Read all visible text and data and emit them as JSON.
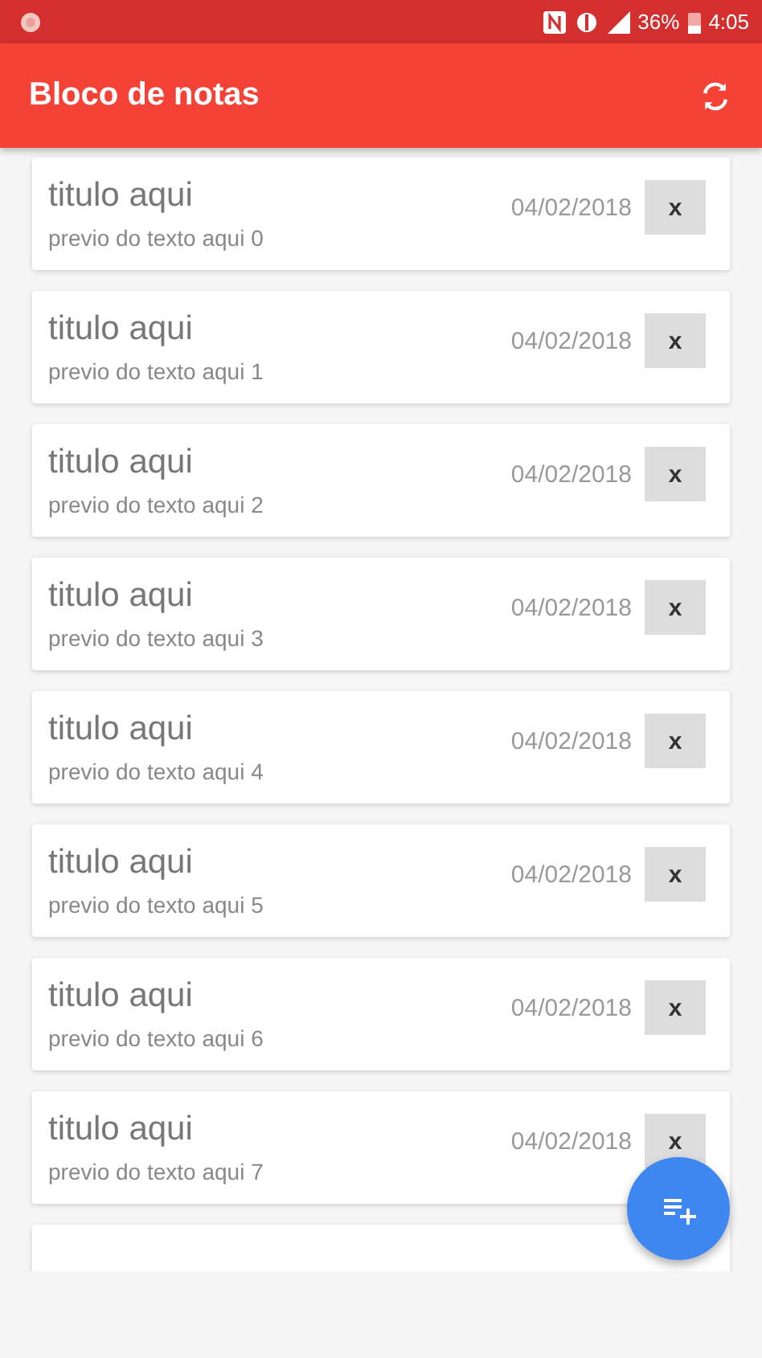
{
  "status_bar": {
    "battery": "36%",
    "time": "4:05"
  },
  "app_bar": {
    "title": "Bloco de notas"
  },
  "notes": [
    {
      "title": "titulo aqui",
      "preview": "previo do texto aqui 0",
      "date": "04/02/2018",
      "delete": "x"
    },
    {
      "title": "titulo aqui",
      "preview": "previo do texto aqui 1",
      "date": "04/02/2018",
      "delete": "x"
    },
    {
      "title": "titulo aqui",
      "preview": "previo do texto aqui 2",
      "date": "04/02/2018",
      "delete": "x"
    },
    {
      "title": "titulo aqui",
      "preview": "previo do texto aqui 3",
      "date": "04/02/2018",
      "delete": "x"
    },
    {
      "title": "titulo aqui",
      "preview": "previo do texto aqui 4",
      "date": "04/02/2018",
      "delete": "x"
    },
    {
      "title": "titulo aqui",
      "preview": "previo do texto aqui 5",
      "date": "04/02/2018",
      "delete": "x"
    },
    {
      "title": "titulo aqui",
      "preview": "previo do texto aqui 6",
      "date": "04/02/2018",
      "delete": "x"
    },
    {
      "title": "titulo aqui",
      "preview": "previo do texto aqui 7",
      "date": "04/02/2018",
      "delete": "x"
    }
  ]
}
